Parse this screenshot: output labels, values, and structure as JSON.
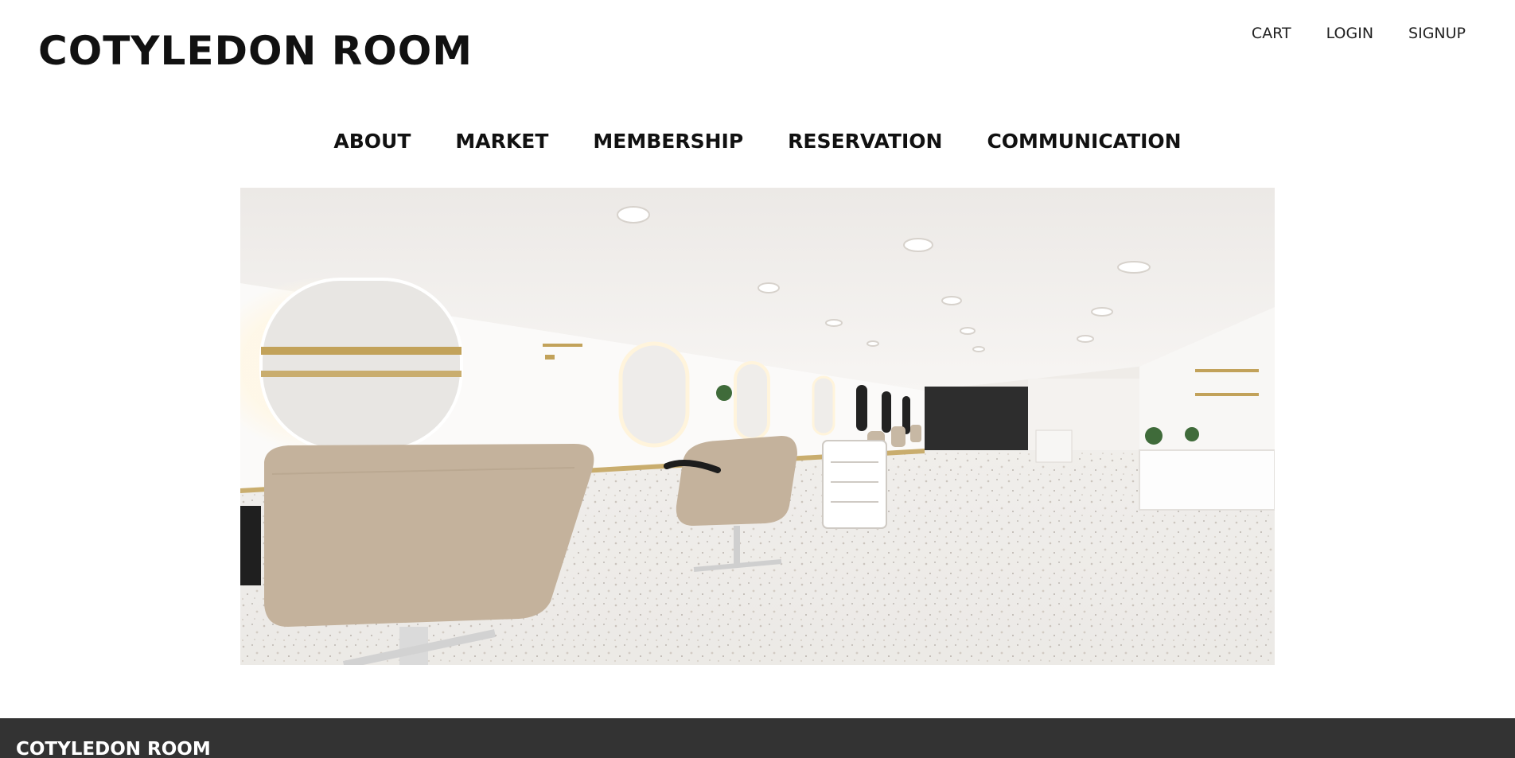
{
  "header": {
    "brand": "COTYLEDON ROOM",
    "utility_nav": [
      {
        "label": "CART"
      },
      {
        "label": "LOGIN"
      },
      {
        "label": "SIGNUP"
      }
    ]
  },
  "main_nav": [
    {
      "label": "ABOUT"
    },
    {
      "label": "MARKET"
    },
    {
      "label": "MEMBERSHIP"
    },
    {
      "label": "RESERVATION"
    },
    {
      "label": "COMMUNICATION"
    }
  ],
  "hero": {
    "image": "salon-interior-photo"
  },
  "footer": {
    "brand": "COTYLEDON ROOM",
    "background": "#333333"
  }
}
